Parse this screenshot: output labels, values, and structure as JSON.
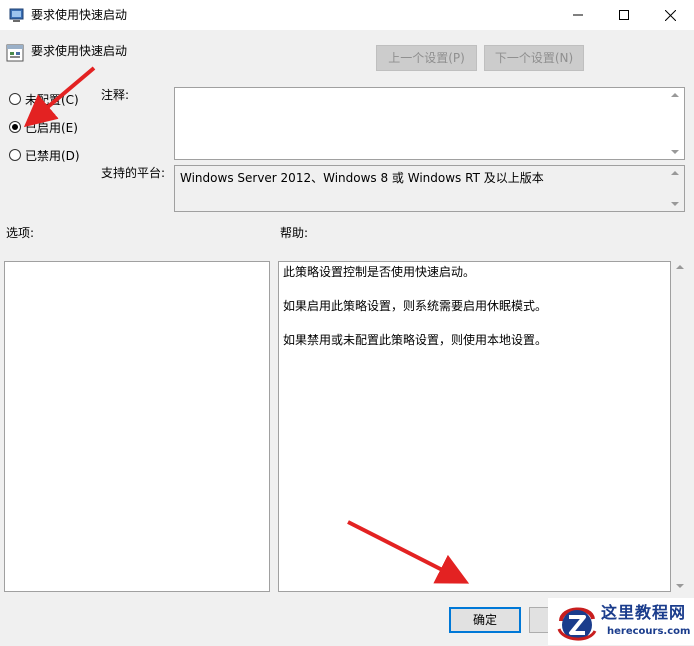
{
  "window": {
    "title": "要求使用快速启动",
    "icons": {
      "app": "policy-window-icon",
      "minimize": "minimize-icon",
      "maximize": "maximize-icon",
      "close": "close-icon"
    }
  },
  "header": {
    "title": "要求使用快速启动",
    "icon": "policy-setting-icon",
    "prev_label": "上一个设置(P)",
    "next_label": "下一个设置(N)"
  },
  "state": {
    "options": [
      {
        "label": "未配置(C)",
        "checked": false
      },
      {
        "label": "已启用(E)",
        "checked": true
      },
      {
        "label": "已禁用(D)",
        "checked": false
      }
    ]
  },
  "comment": {
    "label": "注释:",
    "value": ""
  },
  "platform": {
    "label": "支持的平台:",
    "value": "Windows Server 2012、Windows 8 或 Windows RT 及以上版本"
  },
  "options_pane": {
    "label": "选项:"
  },
  "help_pane": {
    "label": "帮助:",
    "lines": [
      "此策略设置控制是否使用快速启动。",
      "如果启用此策略设置，则系统需要启用休眠模式。",
      "如果禁用或未配置此策略设置，则使用本地设置。"
    ]
  },
  "footer": {
    "ok_label": "确定"
  },
  "watermark": {
    "name": "这里教程网",
    "url": "herecours.com",
    "logo": "z-logo"
  },
  "colors": {
    "accent": "#0078d7",
    "annotation": "#e32222",
    "disabled_button": "#cccccc"
  }
}
